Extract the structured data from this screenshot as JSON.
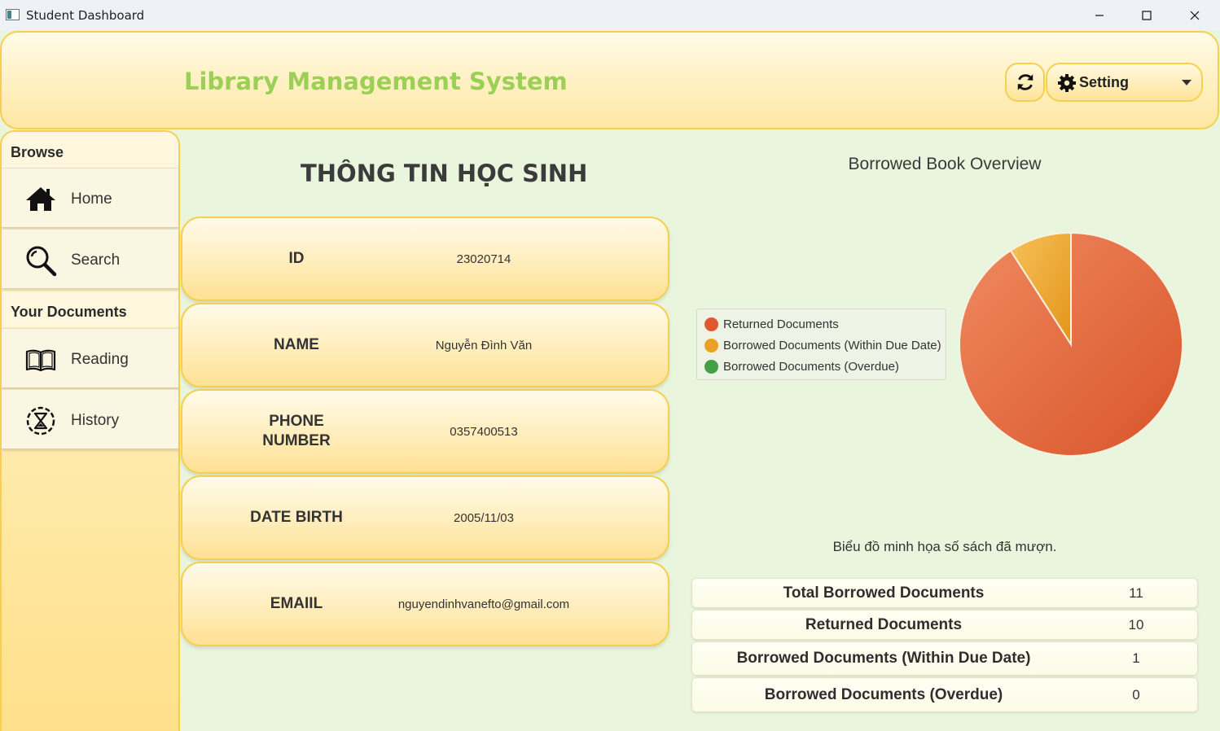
{
  "window": {
    "title": "Student Dashboard"
  },
  "header": {
    "app_title": "Library Management System",
    "setting_label": "Setting"
  },
  "sidebar": {
    "browse_label": "Browse",
    "documents_label": "Your Documents",
    "items": [
      {
        "label": "Home",
        "icon": "home-icon"
      },
      {
        "label": "Search",
        "icon": "search-icon"
      },
      {
        "label": "Reading",
        "icon": "book-icon"
      },
      {
        "label": "History",
        "icon": "history-icon"
      }
    ]
  },
  "student": {
    "title": "THÔNG TIN HỌC SINH",
    "fields": [
      {
        "label": "ID",
        "value": "23020714"
      },
      {
        "label": "NAME",
        "value": "Nguyễn Đình Văn"
      },
      {
        "label": "PHONE\nNUMBER",
        "value": "0357400513"
      },
      {
        "label": "DATE BIRTH",
        "value": "2005/11/03"
      },
      {
        "label": "EMAIIL",
        "value": "nguyendinhvanefto@gmail.com"
      }
    ]
  },
  "chart_data": {
    "type": "pie",
    "title": "Borrowed Book Overview",
    "categories": [
      "Returned Documents",
      "Borrowed Documents (Within Due Date)",
      "Borrowed Documents (Overdue)"
    ],
    "values": [
      10,
      1,
      0
    ],
    "colors": [
      "#e2582e",
      "#eba123",
      "#43a047"
    ],
    "legend": "left",
    "caption": "Biểu đồ minh họa số sách đã mượn."
  },
  "stats": [
    {
      "label": "Total Borrowed Documents",
      "value": "11"
    },
    {
      "label": "Returned Documents",
      "value": "10"
    },
    {
      "label": "Borrowed Documents (Within Due Date)",
      "value": "1"
    },
    {
      "label": "Borrowed Documents (Overdue)",
      "value": "0"
    }
  ]
}
